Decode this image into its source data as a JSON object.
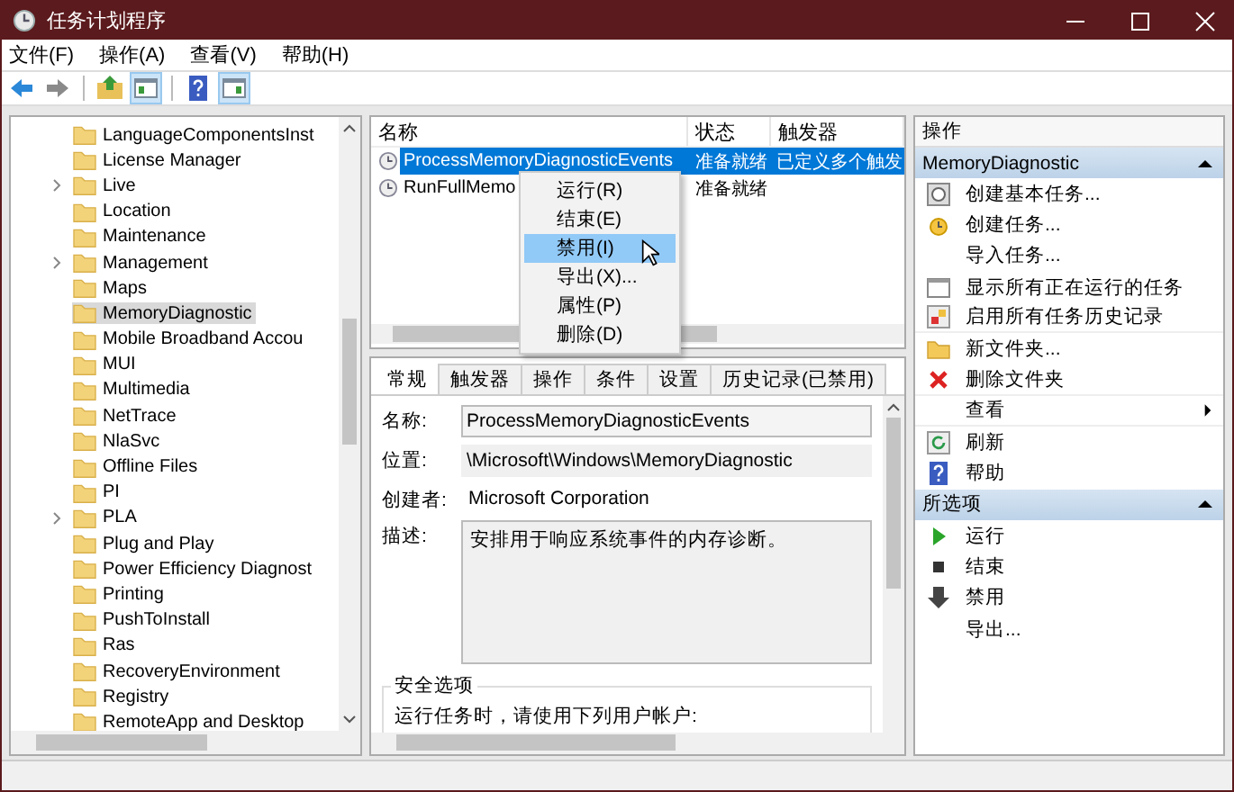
{
  "window": {
    "title": "任务计划程序"
  },
  "menu": [
    "文件(F)",
    "操作(A)",
    "查看(V)",
    "帮助(H)"
  ],
  "toolbar": [
    {
      "kind": "back"
    },
    {
      "kind": "forward"
    },
    {
      "kind": "sep"
    },
    {
      "kind": "up"
    },
    {
      "kind": "pane",
      "selected": true
    },
    {
      "kind": "sep"
    },
    {
      "kind": "help"
    },
    {
      "kind": "pane2",
      "selected": true
    }
  ],
  "tree": {
    "items": [
      {
        "label": "LanguageComponentsInst",
        "has_children": false,
        "selected": false
      },
      {
        "label": "License Manager",
        "has_children": false,
        "selected": false
      },
      {
        "label": "Live",
        "has_children": true,
        "selected": false
      },
      {
        "label": "Location",
        "has_children": false,
        "selected": false
      },
      {
        "label": "Maintenance",
        "has_children": false,
        "selected": false
      },
      {
        "label": "Management",
        "has_children": true,
        "selected": false
      },
      {
        "label": "Maps",
        "has_children": false,
        "selected": false
      },
      {
        "label": "MemoryDiagnostic",
        "has_children": false,
        "selected": true
      },
      {
        "label": "Mobile Broadband Accou",
        "has_children": false,
        "selected": false
      },
      {
        "label": "MUI",
        "has_children": false,
        "selected": false
      },
      {
        "label": "Multimedia",
        "has_children": false,
        "selected": false
      },
      {
        "label": "NetTrace",
        "has_children": false,
        "selected": false
      },
      {
        "label": "NlaSvc",
        "has_children": false,
        "selected": false
      },
      {
        "label": "Offline Files",
        "has_children": false,
        "selected": false
      },
      {
        "label": "PI",
        "has_children": false,
        "selected": false
      },
      {
        "label": "PLA",
        "has_children": true,
        "selected": false
      },
      {
        "label": "Plug and Play",
        "has_children": false,
        "selected": false
      },
      {
        "label": "Power Efficiency Diagnost",
        "has_children": false,
        "selected": false
      },
      {
        "label": "Printing",
        "has_children": false,
        "selected": false
      },
      {
        "label": "PushToInstall",
        "has_children": false,
        "selected": false
      },
      {
        "label": "Ras",
        "has_children": false,
        "selected": false
      },
      {
        "label": "RecoveryEnvironment",
        "has_children": false,
        "selected": false
      },
      {
        "label": "Registry",
        "has_children": false,
        "selected": false
      },
      {
        "label": "RemoteApp and Desktop",
        "has_children": false,
        "selected": false
      }
    ]
  },
  "tasks": {
    "columns": [
      "名称",
      "状态",
      "触发器"
    ],
    "rows": [
      {
        "name": "ProcessMemoryDiagnosticEvents",
        "status": "准备就绪",
        "trigger": "已定义多个触发",
        "selected": true
      },
      {
        "name": "RunFullMemo",
        "status": "准备就绪",
        "selected": false
      }
    ]
  },
  "context_menu": [
    {
      "label": "运行(R)",
      "selected": false
    },
    {
      "label": "结束(E)",
      "selected": false
    },
    {
      "label": "禁用(I)",
      "selected": true
    },
    {
      "label": "导出(X)...",
      "selected": false
    },
    {
      "label": "属性(P)",
      "selected": false
    },
    {
      "label": "删除(D)",
      "selected": false
    }
  ],
  "detail": {
    "tabs": [
      {
        "label": "常规",
        "selected": true
      },
      {
        "label": "触发器",
        "selected": false
      },
      {
        "label": "操作",
        "selected": false
      },
      {
        "label": "条件",
        "selected": false
      },
      {
        "label": "设置",
        "selected": false
      },
      {
        "label": "历史记录(已禁用)",
        "selected": false
      }
    ],
    "fields": [
      {
        "label": "名称:",
        "value": "ProcessMemoryDiagnosticEvents",
        "kind": "input"
      },
      {
        "label": "位置:",
        "value": "\\Microsoft\\Windows\\MemoryDiagnostic",
        "kind": "readonly"
      },
      {
        "label": "创建者:",
        "value": "Microsoft Corporation",
        "kind": "text"
      },
      {
        "label": "描述:",
        "value": "安排用于响应系统事件的内存诊断。",
        "kind": "textarea"
      }
    ],
    "security": {
      "title": "安全选项",
      "text": "运行任务时，请使用下列用户帐户:"
    }
  },
  "actions": {
    "title": "操作",
    "sections": [
      {
        "title": "MemoryDiagnostic",
        "items": [
          {
            "label": "创建基本任务...",
            "kind": "wizard",
            "divider": false
          },
          {
            "label": "创建任务...",
            "kind": "task",
            "divider": false
          },
          {
            "label": "导入任务...",
            "kind": "plain",
            "divider": false
          },
          {
            "label": "显示所有正在运行的任务",
            "kind": "running",
            "divider": false
          },
          {
            "label": "启用所有任务历史记录",
            "kind": "history",
            "divider": true
          },
          {
            "label": "新文件夹...",
            "kind": "folder",
            "divider": false
          },
          {
            "label": "删除文件夹",
            "kind": "delete",
            "divider": true
          },
          {
            "label": "查看",
            "kind": "plain",
            "submenu": true,
            "divider": true
          },
          {
            "label": "刷新",
            "kind": "refresh",
            "divider": false
          },
          {
            "label": "帮助",
            "kind": "help",
            "divider": false
          }
        ]
      },
      {
        "title": "所选项",
        "items": [
          {
            "label": "运行",
            "kind": "run",
            "divider": false
          },
          {
            "label": "结束",
            "kind": "stop",
            "divider": false
          },
          {
            "label": "禁用",
            "kind": "disable",
            "divider": false
          },
          {
            "label": "导出...",
            "kind": "plain",
            "divider": false
          }
        ]
      }
    ]
  }
}
